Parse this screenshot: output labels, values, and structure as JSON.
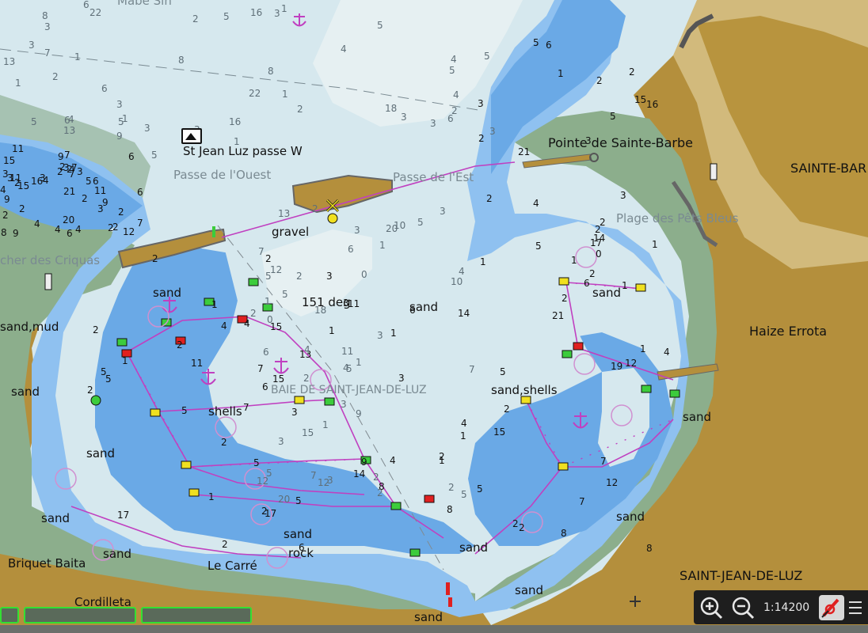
{
  "map": {
    "scale": "1:14200",
    "place_names": [
      {
        "id": "pointe",
        "text": "Pointe de Sainte-Barbe"
      },
      {
        "id": "sainte-barbe",
        "text": "SAINTE-BAR"
      },
      {
        "id": "haize",
        "text": "Haize Errota"
      },
      {
        "id": "saint-jean",
        "text": "SAINT-JEAN-DE-LUZ"
      },
      {
        "id": "briquet",
        "text": "Briquet Baita"
      },
      {
        "id": "cordilleta",
        "text": "Cordilleta"
      },
      {
        "id": "le-carre",
        "text": "Le Carré"
      },
      {
        "id": "photo-label",
        "text": "St Jean Luz passe W"
      }
    ],
    "faint_names": [
      {
        "id": "passe-ouest",
        "text": "Passe de l'Ouest"
      },
      {
        "id": "passe-est",
        "text": "Passe de l'Est"
      },
      {
        "id": "plage",
        "text": "Plage des Pêts Bleus"
      },
      {
        "id": "baie",
        "text": "BAIE DE SAINT-JEAN-DE-LUZ"
      },
      {
        "id": "criquas",
        "text": "cher des Criquas"
      },
      {
        "id": "mabe",
        "text": "Mabe Sin"
      }
    ],
    "seabed": [
      "gravel",
      "sand",
      "sand",
      "sand,mud",
      "sand",
      "shells",
      "sand,shells",
      "sand",
      "sand",
      "sand",
      "sand",
      "sand",
      "rock",
      "sand",
      "sand",
      "sand",
      "sand",
      "sand"
    ],
    "bearing": "151 deg",
    "soundings": [
      "22",
      "5",
      "21",
      "17",
      "17",
      "3",
      "10",
      "7",
      "11",
      "6",
      "22",
      "5",
      "15",
      "14",
      "21",
      "4",
      "20",
      "3",
      "13",
      "15",
      "8",
      "12",
      "4",
      "15",
      "14",
      "18",
      "12",
      "7",
      "5",
      "19",
      "5",
      "11",
      "20",
      "6",
      "21",
      "5",
      "15",
      "12",
      "8",
      "12",
      "1",
      "18",
      "16",
      "14",
      "2",
      "13",
      "3",
      "9",
      "17",
      "2",
      "13",
      "10",
      "15",
      "9",
      "12",
      "9",
      "13",
      "11",
      "5",
      "16",
      "16",
      "4",
      "11",
      "2",
      "15",
      "6",
      "20",
      "9",
      "15",
      "4",
      "16",
      "12",
      "9",
      "11",
      "5",
      "8",
      "5",
      "9",
      "7",
      "7",
      "8",
      "5",
      "11",
      "2",
      "8",
      "5",
      "9",
      "2",
      "6",
      "7",
      "5",
      "7",
      "6",
      "8",
      "1",
      "6",
      "2",
      "6",
      "3",
      "5",
      "6",
      "2",
      "6",
      "5",
      "5",
      "5",
      "7",
      "5",
      "6",
      "5",
      "4",
      "7",
      "4",
      "7",
      "5",
      "5",
      "5",
      "6",
      "4",
      "6",
      "6",
      "3",
      "3",
      "4",
      "1",
      "3",
      "2",
      "4",
      "3",
      "2",
      "4",
      "2",
      "3",
      "1",
      "4",
      "3",
      "2",
      "2",
      "1",
      "4",
      "1",
      "0",
      "2",
      "3",
      "2",
      "3",
      "3",
      "2",
      "2",
      "1",
      "4",
      "2",
      "3",
      "2",
      "1",
      "3",
      "6",
      "7",
      "5",
      "3",
      "2",
      "3",
      "4",
      "2",
      "2",
      "7",
      "3",
      "7",
      "2",
      "8",
      "3",
      "2",
      "3",
      "3",
      "2",
      "5",
      "1",
      "3",
      "2",
      "2",
      "3",
      "1",
      "4",
      "1",
      "3",
      "1",
      "1",
      "2",
      "1",
      "2",
      "2",
      "1",
      "2",
      "1",
      "0",
      "1",
      "6",
      "2",
      "4",
      "2",
      "2",
      "5",
      "2",
      "2",
      "3",
      "1",
      "4",
      "2",
      "5",
      "2",
      "3",
      "4",
      "4",
      "1",
      "1",
      "3",
      "3",
      "2",
      "2",
      "1",
      "2",
      "0",
      "8",
      "1",
      "2",
      "1"
    ]
  },
  "toolbar": {
    "zoom_in": "zoom in",
    "zoom_out": "zoom out",
    "scale_label": "1:14200"
  },
  "colors": {
    "deep_water": "#d6e8ee",
    "shallow_water": "#8fc1f0",
    "very_shallow": "#6aa9e6",
    "intertidal": "#8cae8c",
    "land": "#b48f3c",
    "land_light": "#d2ba7c",
    "route": "#c040c0",
    "buoy_green": "#3ccc3c",
    "buoy_red": "#e02020",
    "buoy_yellow": "#f0e020"
  }
}
